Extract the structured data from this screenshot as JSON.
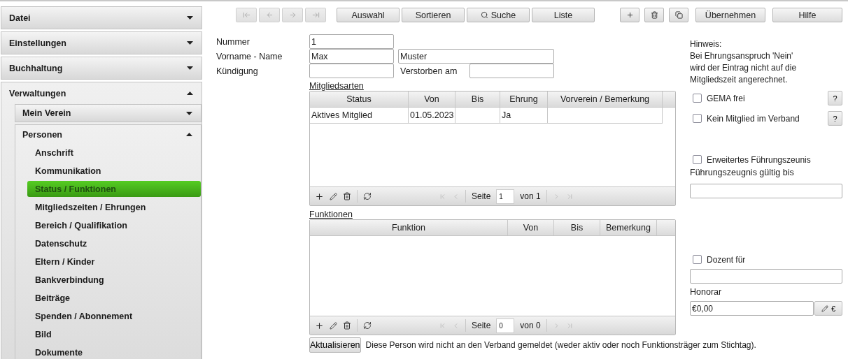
{
  "sidebar": [
    {
      "label": "Datei",
      "expanded": false
    },
    {
      "label": "Einstellungen",
      "expanded": false
    },
    {
      "label": "Buchhaltung",
      "expanded": false
    },
    {
      "label": "Verwaltungen",
      "expanded": true,
      "children": [
        {
          "label": "Mein Verein",
          "expanded": false
        },
        {
          "label": "Personen",
          "expanded": true,
          "children": [
            {
              "label": "Anschrift",
              "selected": false
            },
            {
              "label": "Kommunikation",
              "selected": false
            },
            {
              "label": "Status / Funktionen",
              "selected": true
            },
            {
              "label": "Mitgliedszeiten / Ehrungen",
              "selected": false
            },
            {
              "label": "Bereich / Qualifikation",
              "selected": false
            },
            {
              "label": "Datenschutz",
              "selected": false
            },
            {
              "label": "Eltern / Kinder",
              "selected": false
            },
            {
              "label": "Bankverbindung",
              "selected": false
            },
            {
              "label": "Beiträge",
              "selected": false
            },
            {
              "label": "Spenden / Abonnement",
              "selected": false
            },
            {
              "label": "Bild",
              "selected": false
            },
            {
              "label": "Dokumente",
              "selected": false
            }
          ]
        }
      ]
    }
  ],
  "toolbar": {
    "nav": [
      {
        "kind": "first",
        "disabled": true
      },
      {
        "kind": "prev",
        "disabled": true
      },
      {
        "kind": "next",
        "disabled": true
      },
      {
        "kind": "last",
        "disabled": true
      }
    ],
    "buttons": [
      {
        "label": "Auswahl"
      },
      {
        "label": "Sortieren"
      },
      {
        "label": "Suche",
        "kind": "search"
      },
      {
        "label": "Liste"
      }
    ],
    "actions": [
      {
        "kind": "add"
      },
      {
        "kind": "delete"
      },
      {
        "kind": "copy"
      }
    ],
    "right_buttons": [
      {
        "label": "Übernehmen"
      },
      {
        "label": "Hilfe"
      }
    ]
  },
  "form": {
    "nummer": {
      "label": "Nummer",
      "value": "1"
    },
    "name": {
      "label": "Vorname - Name",
      "first": "Max",
      "last": "Muster"
    },
    "kuendigung": {
      "label": "Kündigung"
    },
    "verstorben": {
      "label": "Verstorben am"
    }
  },
  "tables": [
    {
      "title": "Mitgliedsarten",
      "columns": [
        "Status",
        "Von",
        "Bis",
        "Ehrung",
        "Vorverein / Bemerkung"
      ],
      "rows": [
        [
          "Aktives Mitglied",
          "01.05.2023",
          null,
          "Ja",
          null
        ]
      ],
      "pager": {
        "page_label": "Seite",
        "page": "1",
        "of": "von 1"
      }
    },
    {
      "title": "Funktionen",
      "columns": [
        "Funktion",
        "Von",
        "Bis",
        "Bemerkung"
      ],
      "pager": {
        "page_label": "Seite",
        "page": "0",
        "of": "von 0"
      }
    }
  ],
  "footer": {
    "button": "Aktualisieren",
    "note": "Diese Person wird nicht an den Verband gemeldet (weder aktiv oder noch Funktionsträger zum Stichtag)."
  },
  "right": {
    "hint": "Hinweis:\nBei Ehrungsanspruch 'Nein'\nwird der Eintrag nicht auf die\nMitgliedszeit angerechnet.",
    "options": [
      {
        "label": "GEMA frei",
        "checked": false,
        "help": "?"
      },
      {
        "label": "Kein Mitglied im Verband",
        "checked": false,
        "help": "?"
      }
    ],
    "zeugnis": {
      "label": "Erweitertes Führungszeunis",
      "checked": false,
      "field_label": "Führungszeugnis gültig bis"
    },
    "dozent": {
      "label": "Dozent für",
      "checked": false,
      "honorar_label": "Honorar",
      "honorar": "€0,00",
      "currency": "€"
    }
  }
}
